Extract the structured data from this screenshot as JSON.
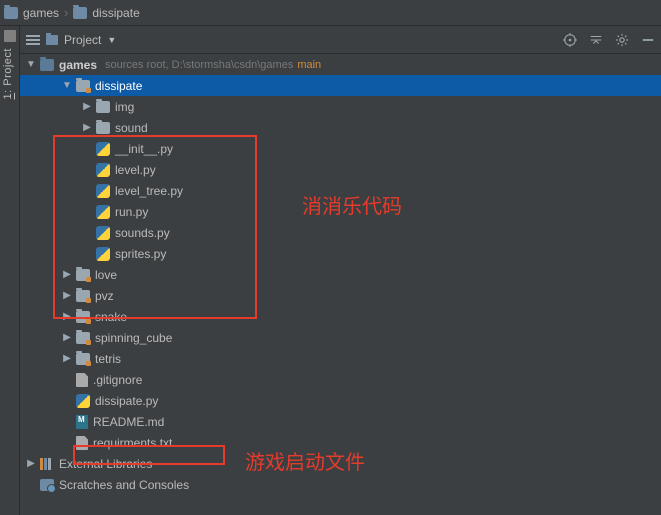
{
  "breadcrumb": [
    {
      "label": "games"
    },
    {
      "label": "dissipate"
    }
  ],
  "sidebar_tab": {
    "num": "1",
    "label": "Project"
  },
  "toolbar": {
    "title": "Project"
  },
  "root": {
    "name": "games",
    "hint": "sources root,  D:\\stormsha\\csdn\\games",
    "branch": "main"
  },
  "tree": [
    {
      "name": "dissipate",
      "type": "folder-orange",
      "indent": 2,
      "arrow": "down",
      "selected": true
    },
    {
      "name": "img",
      "type": "folder",
      "indent": 3,
      "arrow": "right"
    },
    {
      "name": "sound",
      "type": "folder",
      "indent": 3,
      "arrow": "right"
    },
    {
      "name": "__init__.py",
      "type": "py",
      "indent": 3,
      "arrow": "none"
    },
    {
      "name": "level.py",
      "type": "py",
      "indent": 3,
      "arrow": "none"
    },
    {
      "name": "level_tree.py",
      "type": "py",
      "indent": 3,
      "arrow": "none"
    },
    {
      "name": "run.py",
      "type": "py",
      "indent": 3,
      "arrow": "none"
    },
    {
      "name": "sounds.py",
      "type": "py",
      "indent": 3,
      "arrow": "none"
    },
    {
      "name": "sprites.py",
      "type": "py",
      "indent": 3,
      "arrow": "none"
    },
    {
      "name": "love",
      "type": "folder-orange",
      "indent": 2,
      "arrow": "right"
    },
    {
      "name": "pvz",
      "type": "folder-orange",
      "indent": 2,
      "arrow": "right"
    },
    {
      "name": "snake",
      "type": "folder-orange",
      "indent": 2,
      "arrow": "right"
    },
    {
      "name": "spinning_cube",
      "type": "folder-orange",
      "indent": 2,
      "arrow": "right"
    },
    {
      "name": "tetris",
      "type": "folder-orange",
      "indent": 2,
      "arrow": "right"
    },
    {
      "name": ".gitignore",
      "type": "txt",
      "indent": 2,
      "arrow": "none"
    },
    {
      "name": "dissipate.py",
      "type": "py",
      "indent": 2,
      "arrow": "none"
    },
    {
      "name": "README.md",
      "type": "md",
      "indent": 2,
      "arrow": "none"
    },
    {
      "name": "requirments.txt",
      "type": "txt",
      "indent": 2,
      "arrow": "none"
    }
  ],
  "externals": {
    "label": "External Libraries"
  },
  "scratches": {
    "label": "Scratches and Consoles"
  },
  "annotations": {
    "code_group": "消消乐代码",
    "launcher": "游戏启动文件"
  }
}
